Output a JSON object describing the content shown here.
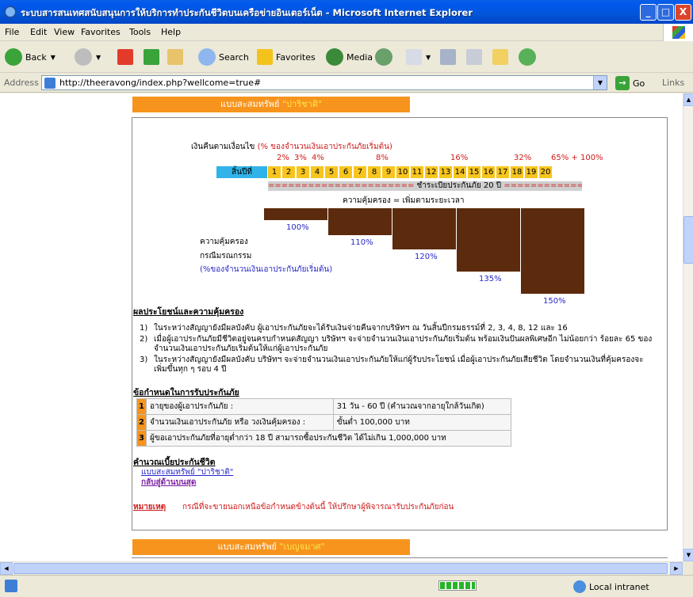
{
  "window": {
    "title": "ระบบสารสนเทศสนับสนุนการให้บริการทำประกันชีวิตบนเครือข่ายอินเตอร์เน็ต - Microsoft Internet Explorer",
    "minimize": "_",
    "maximize": "□",
    "close": "X"
  },
  "menu": [
    "File",
    "Edit",
    "View",
    "Favorites",
    "Tools",
    "Help"
  ],
  "toolbar": {
    "back": "Back",
    "search": "Search",
    "favorites": "Favorites",
    "media": "Media"
  },
  "address": {
    "label": "Address",
    "url": "http://theeravong/index.php?wellcome=true#",
    "go": "Go",
    "links": "Links"
  },
  "status": {
    "zone": "Local intranet",
    "progress_fraction": 1.0
  },
  "plan1": {
    "header_prefix": "แบบสะสมทรัพย์ ",
    "header_name": "\"ปาริชาติ\"",
    "refund_prefix": "เงินคืนตามเงื่อนไข ",
    "refund_note": "(% ของจำนวนเงินเอาประกันภัยเริ่มต้น)",
    "refund_percents": [
      "2%",
      "3%",
      "4%",
      "8%",
      "16%",
      "32%",
      "65% + 100%"
    ],
    "year_label": "สิ้นปีที่",
    "years": [
      "1",
      "2",
      "3",
      "4",
      "5",
      "6",
      "7",
      "8",
      "9",
      "10",
      "11",
      "12",
      "13",
      "14",
      "15",
      "16",
      "17",
      "18",
      "19",
      "20"
    ],
    "premium_bar_left": "======================",
    "premium_bar_text": " ชำระเบี้ยประกันภัย 20 ปี ",
    "premium_bar_right": "======================",
    "coverage_title": "ความคุ้มครอง = เพิ่มตามระยะเวลา",
    "coverage_steps": [
      100,
      110,
      120,
      135,
      150
    ],
    "coverage_step_labels": [
      "100%",
      "110%",
      "120%",
      "135%",
      "150%"
    ],
    "coverage_label1": "ความคุ้มครอง",
    "coverage_label2": "กรณีมรณกรรม",
    "coverage_label3": "(%ของจำนวนเงินเอาประกันภัยเริ่มต้น)"
  },
  "benefits": {
    "heading": "ผลประโยชน์และความคุ้มครอง",
    "items": [
      {
        "n": "1)",
        "text": "ในระหว่างสัญญายังมีผลบังคับ ผู้เอาประกันภัยจะได้รับเงินจ่ายคืนจากบริษัทฯ ณ วันสิ้นปีกรมธรรม์ที่ 2, 3, 4, 8, 12 และ 16"
      },
      {
        "n": "2)",
        "text": "เมื่อผู้เอาประกันภัยมีชีวิตอยู่จนครบกำหนดสัญญา บริษัทฯ จะจ่ายจำนวนเงินเอาประกันภัยเริ่มต้น พร้อมเงินปันผลพิเศษอีก ไม่น้อยกว่า ร้อยละ 65 ของจำนวนเงินเอาประกันภัยเริ่มต้นให้แก่ผู้เอาประกันภัย"
      },
      {
        "n": "3)",
        "text": "ในระหว่างสัญญายังมีผลบังคับ บริษัทฯ จะจ่ายจำนวนเงินเอาประกันภัยให้แก่ผู้รับประโยชน์ เมื่อผู้เอาประกันภัยเสียชีวิต โดยจำนวนเงินที่คุ้มครองจะเพิ่มขึ้นทุก ๆ รอบ 4 ปี"
      }
    ]
  },
  "conditions": {
    "heading": "ข้อกำหนดในการรับประกันภัย",
    "rows": [
      {
        "n": "1",
        "label": "อายุของผู้เอาประกันภัย :",
        "value": "31 วัน - 60 ปี (คำนวณจากอายุใกล้วันเกิด)"
      },
      {
        "n": "2",
        "label": "จำนวนเงินเอาประกันภัย หรือ วงเงินคุ้มครอง :",
        "value": "ขั้นต่ำ 100,000 บาท"
      },
      {
        "n": "3",
        "label": "ผู้ขอเอาประกันภัยที่อายุต่ำกว่า 18 ปี สามารถซื้อประกันชีวิต ได้ไม่เกิน 1,000,000 บาท",
        "value": ""
      }
    ]
  },
  "calc": {
    "heading": "คำนวณเบี้ยประกันชีวิต",
    "link": "แบบสะสมทรัพย์ \"ปาริชาติ\"",
    "back_top": "กลับสู่ด้านบนสุด"
  },
  "note": {
    "label": "หมายเหตุ",
    "text": "กรณีที่จะขายนอกเหนือข้อกำหนดข้างต้นนี้ ให้ปรึกษาผู้พิจารณารับประกันภัยก่อน"
  },
  "plan2": {
    "header_prefix": "แบบสะสมทรัพย์ ",
    "header_name": "\"เบญจมาศ\""
  },
  "colors": {
    "section_orange": "#f7941d",
    "year_blue": "#2fb3e8",
    "year_yellow": "#f7c51e",
    "coverage_brown": "#5c2a0c",
    "refund_red": "#d01a1a",
    "percent_blue": "#2727c9"
  }
}
